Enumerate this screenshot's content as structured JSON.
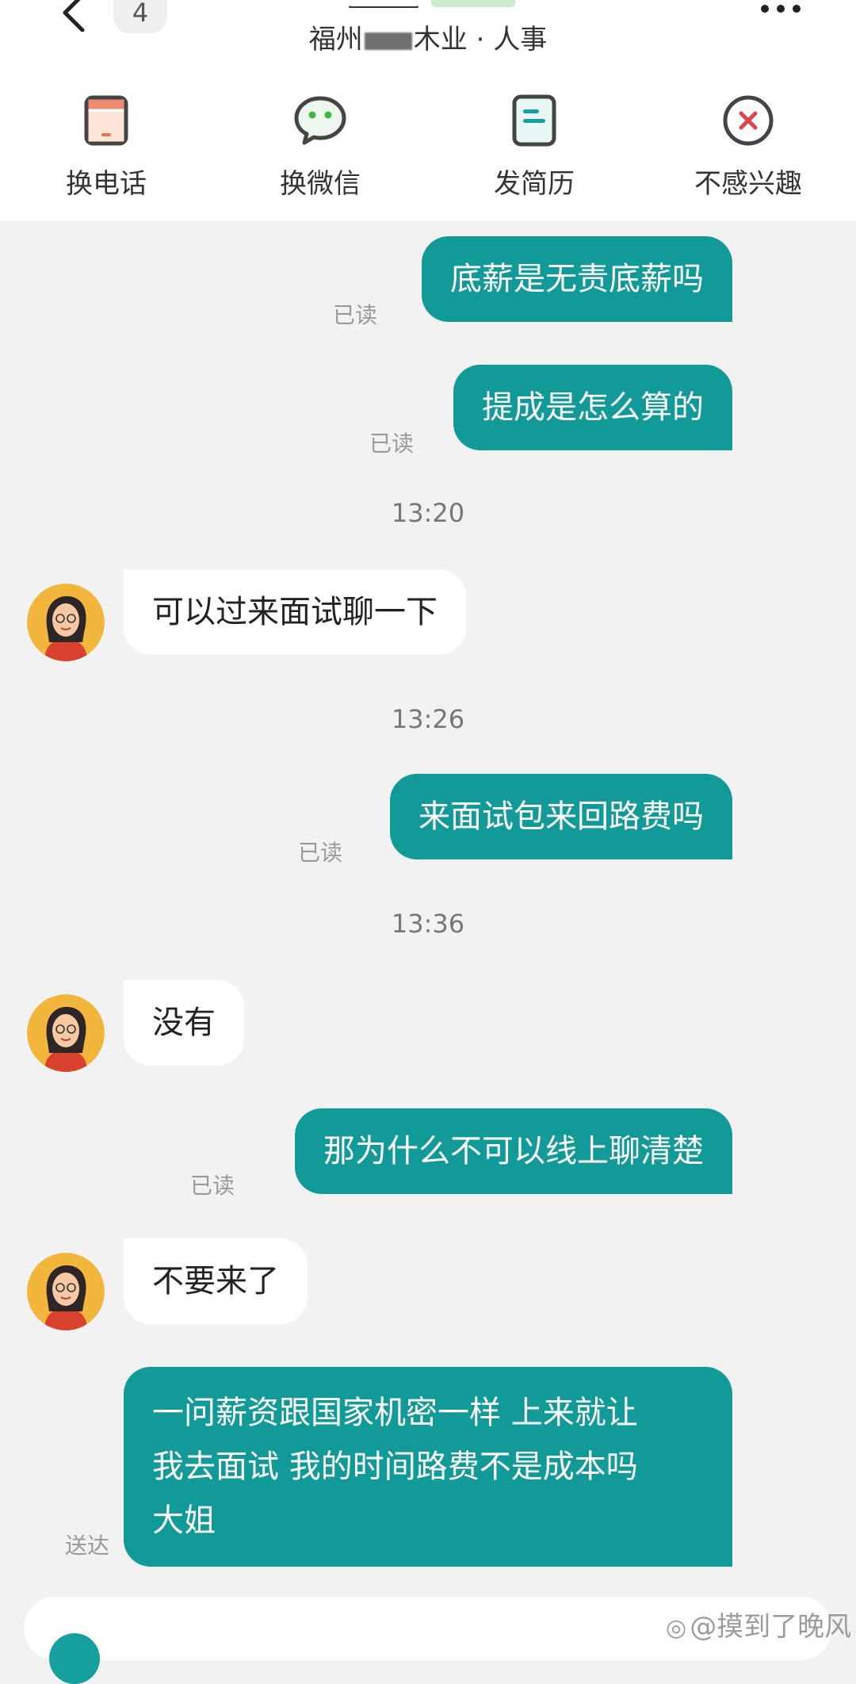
{
  "header": {
    "unread_count": "4",
    "subtitle_prefix": "福州",
    "subtitle_suffix": "木业 · 人事",
    "actions": [
      {
        "label": "换电话",
        "icon": "phone-card-icon"
      },
      {
        "label": "换微信",
        "icon": "wechat-icon"
      },
      {
        "label": "发简历",
        "icon": "resume-icon"
      },
      {
        "label": "不感兴趣",
        "icon": "not-interested-icon"
      }
    ]
  },
  "messages": [
    {
      "from": "me",
      "text": "底薪是无责底薪吗",
      "status": "已读"
    },
    {
      "from": "me",
      "text": "提成是怎么算的",
      "status": "已读"
    },
    {
      "time": "13:20"
    },
    {
      "from": "them",
      "text": "可以过来面试聊一下"
    },
    {
      "time": "13:26"
    },
    {
      "from": "me",
      "text": "来面试包来回路费吗",
      "status": "已读"
    },
    {
      "time": "13:36"
    },
    {
      "from": "them",
      "text": "没有"
    },
    {
      "from": "me",
      "text": "那为什么不可以线上聊清楚",
      "status": "已读"
    },
    {
      "from": "them",
      "text": "不要来了"
    },
    {
      "from": "me",
      "lines": [
        "一问薪资跟国家机密一样 上来就让",
        "我去面试 我的时间路费不是成本吗",
        "大姐"
      ],
      "status": "送达"
    }
  ],
  "watermark": "@摸到了晚风",
  "colors": {
    "accent": "#129a98",
    "background": "#f2f2f2",
    "incoming_bubble": "#ffffff",
    "read_status": "#9a9a9a"
  }
}
